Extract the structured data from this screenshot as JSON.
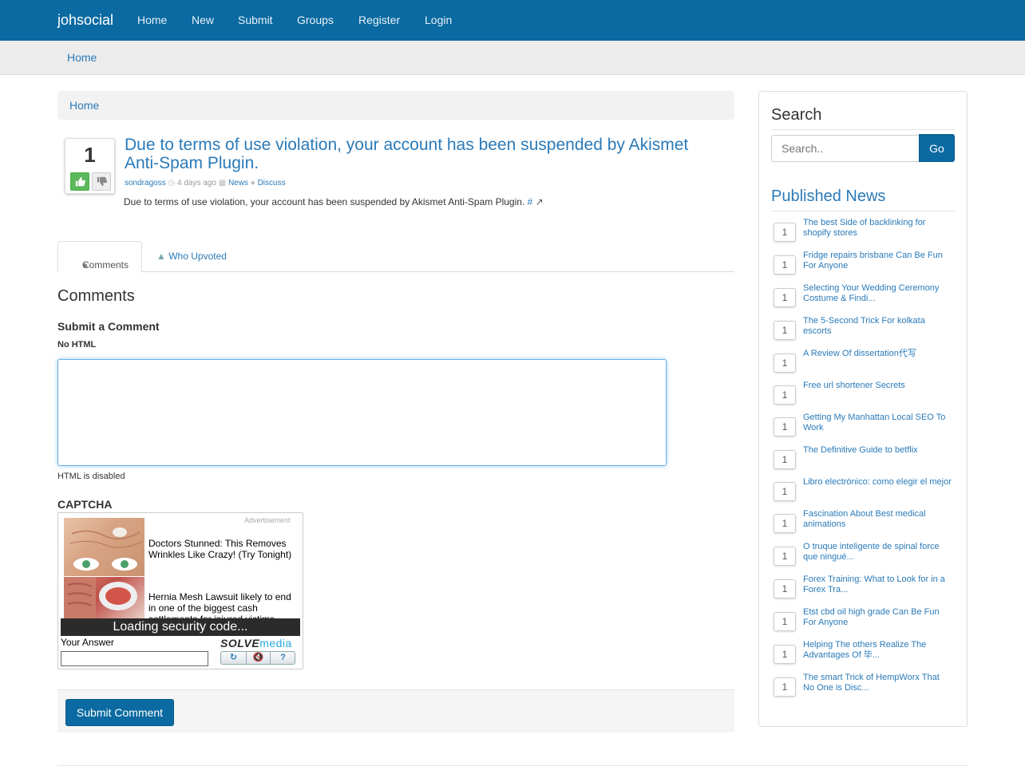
{
  "navbar": {
    "brand": "johsocial",
    "links": [
      "Home",
      "New",
      "Submit",
      "Groups",
      "Register",
      "Login"
    ]
  },
  "subbar": {
    "home": "Home"
  },
  "breadcrumb": {
    "home": "Home"
  },
  "post": {
    "votes": "1",
    "title": "Due to terms of use violation, your account has been suspended by Akismet Anti-Spam Plugin.",
    "author": "sondragoss",
    "time": "4 days ago",
    "category": "News",
    "discuss": "Discuss",
    "description": "Due to terms of use violation, your account has been suspended by Akismet Anti-Spam Plugin.",
    "hash_link": "#"
  },
  "tabs": {
    "comments": "Comments",
    "who_upvoted": "Who Upvoted"
  },
  "comments": {
    "heading": "Comments",
    "submit_heading": "Submit a Comment",
    "no_html": "No HTML",
    "html_disabled": "HTML is disabled",
    "captcha_heading": "CAPTCHA",
    "submit_button": "Submit Comment"
  },
  "captcha": {
    "ad_label": "Advertisement",
    "ad1": "Doctors Stunned: This Removes Wrinkles Like Crazy! (Try Tonight)",
    "ad2": "Hernia Mesh Lawsuit likely to end in one of the biggest cash settlements for injured victims",
    "loading": "Loading security code...",
    "answer_label": "Your Answer",
    "logo_solve": "SOLVE",
    "logo_media": "media",
    "help": "?"
  },
  "sidebar": {
    "search_heading": "Search",
    "search_placeholder": "Search..",
    "go": "Go",
    "published_heading": "Published News",
    "news": [
      {
        "count": "1",
        "title": "The best Side of backlinking for shopify stores"
      },
      {
        "count": "1",
        "title": "Fridge repairs brisbane Can Be Fun For Anyone"
      },
      {
        "count": "1",
        "title": "Selecting Your Wedding Ceremony Costume & Findi..."
      },
      {
        "count": "1",
        "title": "The 5-Second Trick For kolkata escorts"
      },
      {
        "count": "1",
        "title": "A Review Of dissertation代写"
      },
      {
        "count": "1",
        "title": "Free url shortener Secrets"
      },
      {
        "count": "1",
        "title": "Getting My Manhattan Local SEO To Work"
      },
      {
        "count": "1",
        "title": "The Definitive Guide to betflix"
      },
      {
        "count": "1",
        "title": "Libro electrónico: como elegir el mejor"
      },
      {
        "count": "1",
        "title": "Fascination About Best medical animations"
      },
      {
        "count": "1",
        "title": "O truque inteligente de spinal force que ningué..."
      },
      {
        "count": "1",
        "title": "Forex Training: What to Look for in a Forex Tra..."
      },
      {
        "count": "1",
        "title": "Etst cbd oil high grade Can Be Fun For Anyone"
      },
      {
        "count": "1",
        "title": "Helping The others Realize The Advantages Of 毕..."
      },
      {
        "count": "1",
        "title": "The smart Trick of HempWorx That No One is Disc..."
      }
    ]
  }
}
